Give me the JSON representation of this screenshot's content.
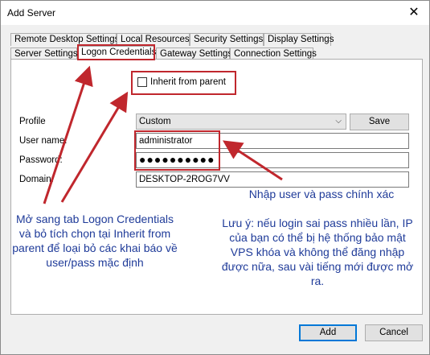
{
  "window": {
    "title": "Add Server",
    "close_label": "✕"
  },
  "tabs_row1": [
    "Remote Desktop Settings",
    "Local Resources",
    "Security Settings",
    "Display Settings"
  ],
  "tabs_row2": [
    "Server Settings",
    "Logon Credentials",
    "Gateway Settings",
    "Connection Settings"
  ],
  "active_tab": "Logon Credentials",
  "inherit": {
    "label": "Inherit from parent",
    "checked": false
  },
  "form": {
    "profile_label": "Profile",
    "profile_value": "Custom",
    "save_label": "Save",
    "username_label": "User name:",
    "username_value": "administrator",
    "password_label": "Password:",
    "password_value": "●●●●●●●●●●",
    "domain_label": "Domain:",
    "domain_value": "DESKTOP-2ROG7VV"
  },
  "annotations": {
    "note_user_pass": "Nhập user và pass chính xác",
    "note_tab": "Mở sang tab Logon Credentials và bỏ tích chọn tại Inherit from parent để loại bỏ các khai báo về user/pass mặc định",
    "note_warning": "Lưu ý: nếu login sai pass nhiều lần, IP của bạn có thể bị hệ thống bảo mật VPS khóa và không thể đăng nhập được nữa, sau vài tiếng mới được mở ra."
  },
  "buttons": {
    "add_label": "Add",
    "cancel_label": "Cancel"
  },
  "colors": {
    "annotation_red": "#c0272d",
    "annotation_text": "#1f3b99",
    "accent": "#0078d7"
  }
}
